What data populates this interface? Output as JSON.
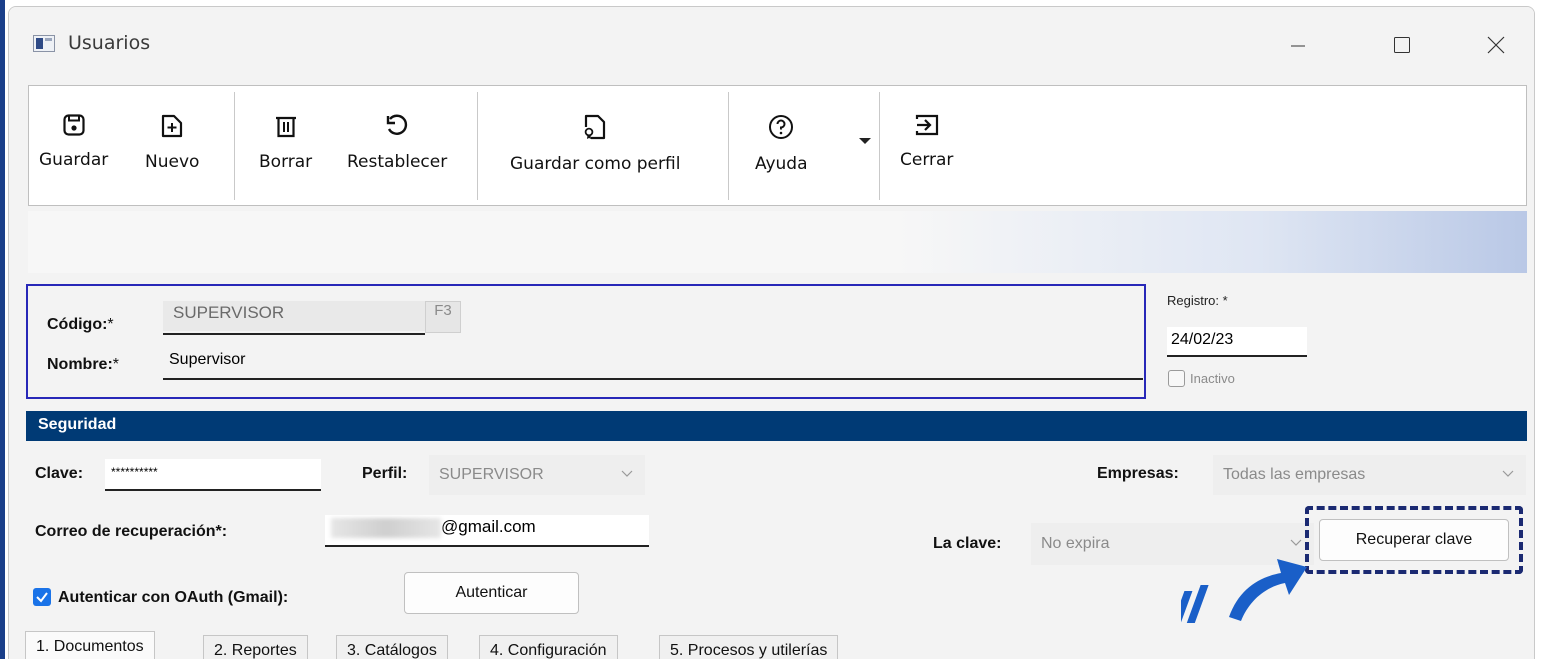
{
  "window": {
    "title": "Usuarios"
  },
  "toolbar": {
    "save": "Guardar",
    "new": "Nuevo",
    "delete": "Borrar",
    "reset": "Restablecer",
    "save_profile": "Guardar como perfil",
    "help": "Ayuda",
    "close": "Cerrar"
  },
  "user": {
    "code_label": "Código:",
    "code_value": "SUPERVISOR",
    "f3": "F3",
    "name_label": "Nombre:",
    "name_value": "Supervisor",
    "required_mark": "*",
    "registro_label": "Registro: *",
    "registro_value": "24/02/23",
    "inactive_label": "Inactivo"
  },
  "security": {
    "header": "Seguridad",
    "password_label": "Clave:",
    "password_value": "**********",
    "profile_label": "Perfil:",
    "profile_value": "SUPERVISOR",
    "companies_label": "Empresas:",
    "companies_value": "Todas las empresas",
    "recovery_label": "Correo de recuperación*:",
    "recovery_value": "@gmail.com",
    "expiry_label": "La clave:",
    "expiry_value": "No expira",
    "recover_button": "Recuperar clave",
    "oauth_label": "Autenticar con OAuth (Gmail):",
    "oauth_button": "Autenticar"
  },
  "tabs": [
    "1. Documentos",
    "2. Reportes",
    "3. Catálogos",
    "4. Configuración",
    "5. Procesos y utilerías"
  ],
  "colors": {
    "section_header": "#003a75",
    "frame_border": "#2828b8",
    "highlight_dash": "#1b2a72",
    "arrow": "#1a5fc8"
  }
}
